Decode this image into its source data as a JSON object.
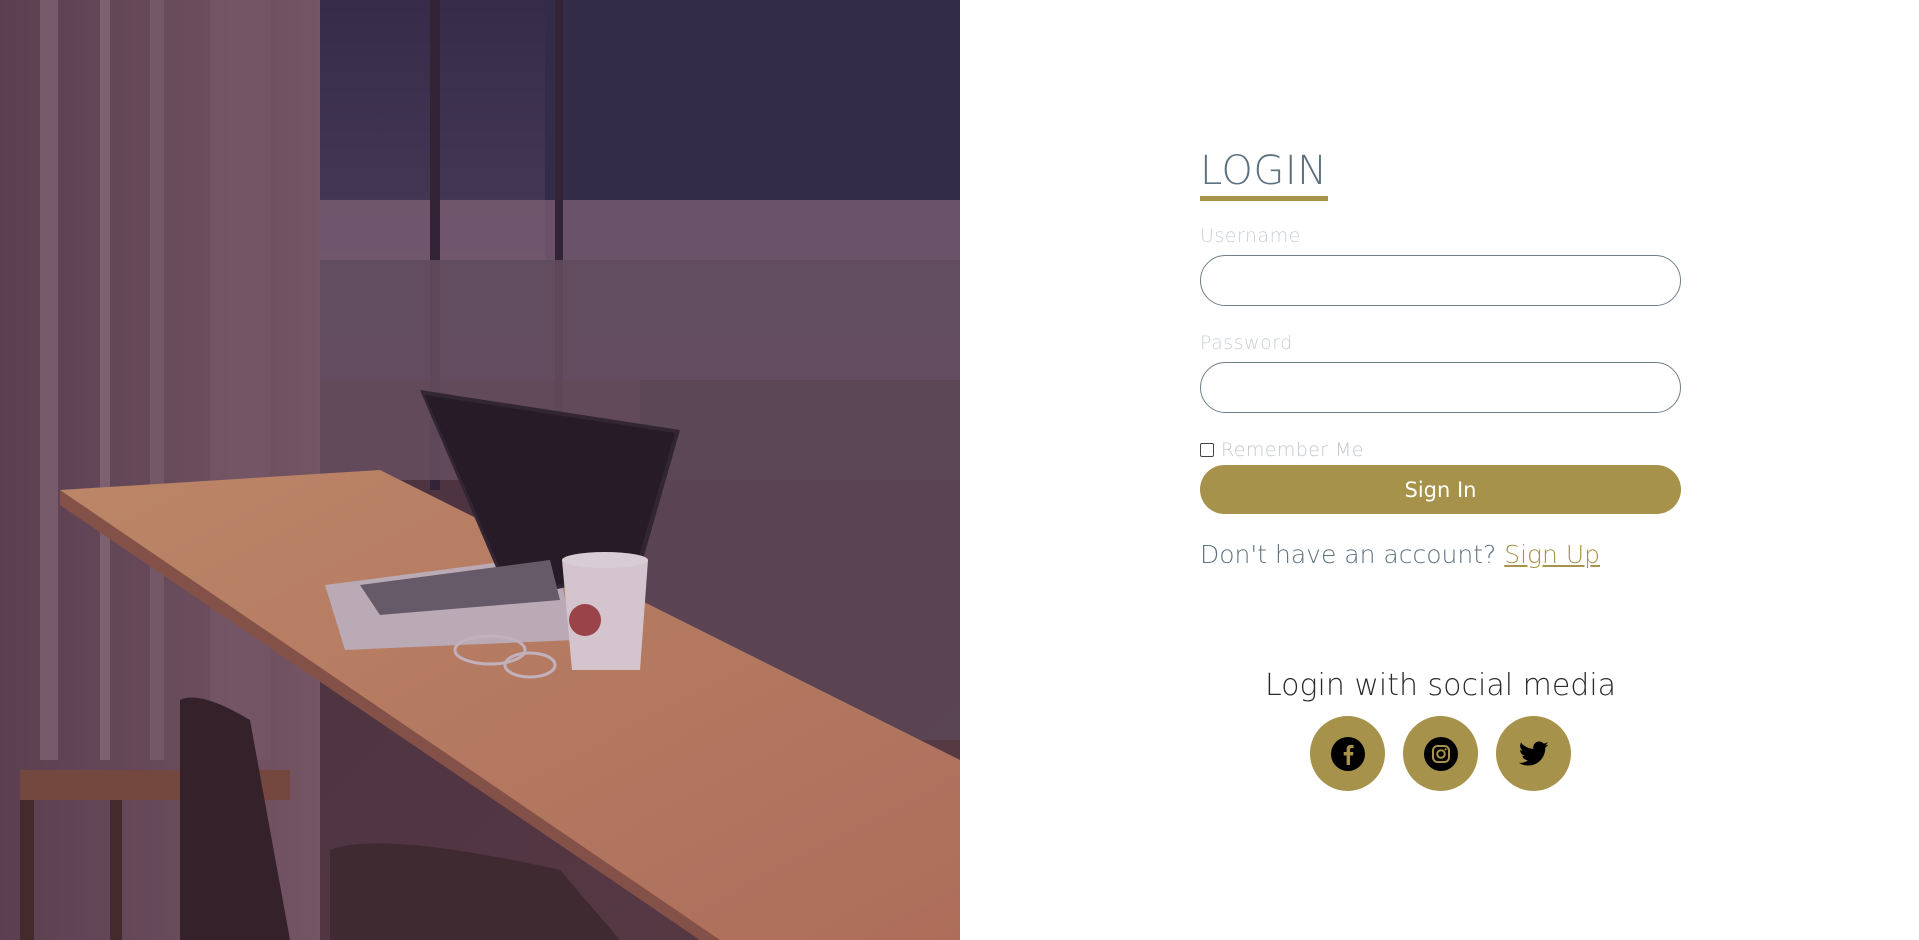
{
  "login": {
    "title": "LOGIN",
    "username_label": "Username",
    "username_value": "",
    "password_label": "Password",
    "password_value": "",
    "remember_label": "Remember Me",
    "remember_checked": false,
    "signin_label": "Sign In",
    "signup_prompt": "Don't have an account?",
    "signup_link": "Sign Up"
  },
  "social": {
    "title": "Login with social media",
    "buttons": [
      {
        "icon": "facebook-icon"
      },
      {
        "icon": "instagram-icon"
      },
      {
        "icon": "twitter-icon"
      }
    ]
  },
  "colors": {
    "accent": "#a6924a",
    "title_text": "#5d7280",
    "input_border": "#6f7f88",
    "label_text": "#c9cfd3"
  }
}
